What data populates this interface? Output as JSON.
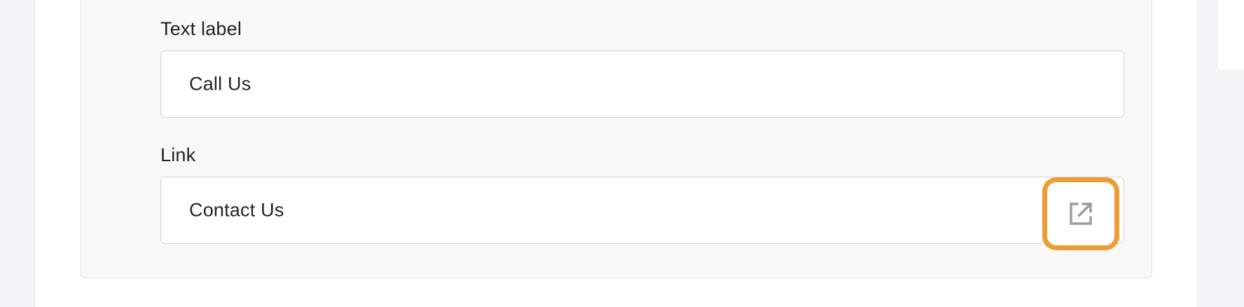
{
  "form": {
    "text_label": {
      "label": "Text label",
      "value": "Call Us"
    },
    "link": {
      "label": "Link",
      "value": "Contact Us",
      "action_icon": "external-link-icon"
    }
  },
  "colors": {
    "highlight": "#ef9c35",
    "card_background": "#f8f8f8",
    "input_border": "#d0d3d7",
    "icon": "#9a9da1"
  }
}
